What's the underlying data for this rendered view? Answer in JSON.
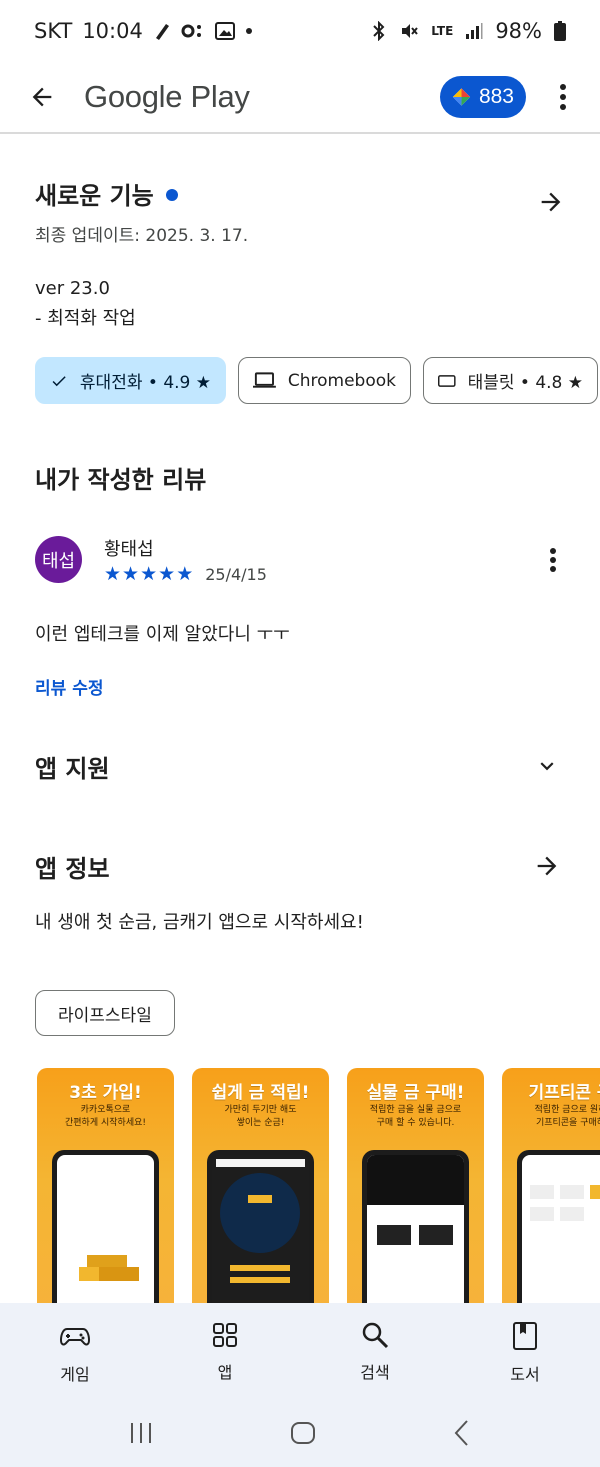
{
  "status_bar": {
    "carrier": "SKT",
    "time": "10:04",
    "network": "LTE",
    "battery": "98%"
  },
  "app_bar": {
    "title": "Google Play",
    "points": "883"
  },
  "whats_new": {
    "title": "새로운 기능",
    "updated": "최종 업데이트: 2025. 3. 17.",
    "version": "ver 23.0",
    "note": "- 최적화 작업"
  },
  "device_chips": [
    {
      "label": "휴대전화 • 4.9 ★",
      "selected": true
    },
    {
      "label": "Chromebook",
      "selected": false
    },
    {
      "label": "태블릿 • 4.8 ★",
      "selected": false
    }
  ],
  "my_review": {
    "title": "내가 작성한 리뷰",
    "avatar_text": "태섭",
    "reviewer_name": "황태섭",
    "rating": 5,
    "date": "25/4/15",
    "text": "이런 엡테크를 이제 알았다니 ㅜㅜ",
    "edit_label": "리뷰 수정"
  },
  "app_support": {
    "title": "앱 지원"
  },
  "app_info": {
    "title": "앱 정보",
    "description": "내 생애 첫 순금, 금캐기 앱으로 시작하세요!",
    "category": "라이프스타일"
  },
  "screenshots": [
    {
      "title": "3초 가입!",
      "subtitle": "카카오톡으로\n간편하게 시작하세요!"
    },
    {
      "title": "쉽게 금 적립!",
      "subtitle": "가만히 두기만 해도\n쌓이는 순금!"
    },
    {
      "title": "실물 금 구매!",
      "subtitle": "적립한 금을 실물 금으로\n구매 할 수 있습니다."
    },
    {
      "title": "기프티콘 구",
      "subtitle": "적립한 금으로 원하\n기프티콘을 구매하"
    }
  ],
  "bottom_nav": [
    {
      "label": "게임",
      "icon": "gamepad-icon"
    },
    {
      "label": "앱",
      "icon": "apps-grid-icon"
    },
    {
      "label": "검색",
      "icon": "search-icon"
    },
    {
      "label": "도서",
      "icon": "book-icon"
    }
  ],
  "colors": {
    "accent": "#0b57d0",
    "chip_selected": "#c2e7ff",
    "avatar": "#6a1b9a",
    "nav_bg": "#eef2f9"
  }
}
